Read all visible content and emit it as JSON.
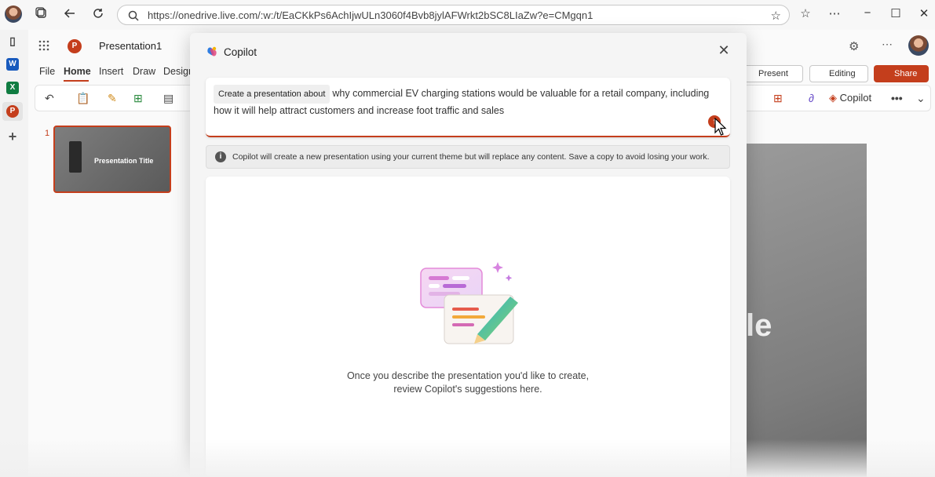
{
  "browser": {
    "url": "https://onedrive.live.com/:w:/t/EaCKkPs6AchIjwULn3060f4Bvb8jylAFWrkt2bSC8LIaZw?e=CMgqn1",
    "back_icon": "back-arrow-icon",
    "refresh_icon": "refresh-icon"
  },
  "rail": {
    "word_label": "W",
    "excel_label": "X",
    "ppt_label": "P"
  },
  "app": {
    "logo_label": "P",
    "doc_title": "Presentation1",
    "tabs": [
      "File",
      "Home",
      "Insert",
      "Draw",
      "Design"
    ],
    "present_label": "Present",
    "editing_label": "Editing",
    "share_label": "Share",
    "copilot_label": "Copilot",
    "more_label": "•••"
  },
  "slides": {
    "number": "1",
    "thumb_title": "Presentation Title",
    "canvas_text": "le"
  },
  "copilot": {
    "title": "Copilot",
    "prompt_chip": "Create a presentation about",
    "prompt_text": "why commercial EV charging stations would be valuable for a retail company, including how it will help attract customers and increase foot traffic and sales",
    "info_text": "Copilot will create a new presentation using your current theme but will replace any content. Save a copy to avoid losing your work.",
    "empty_line1": "Once you describe the presentation you'd like to create,",
    "empty_line2": "review Copilot's suggestions here.",
    "accent": "#c43e1c"
  }
}
